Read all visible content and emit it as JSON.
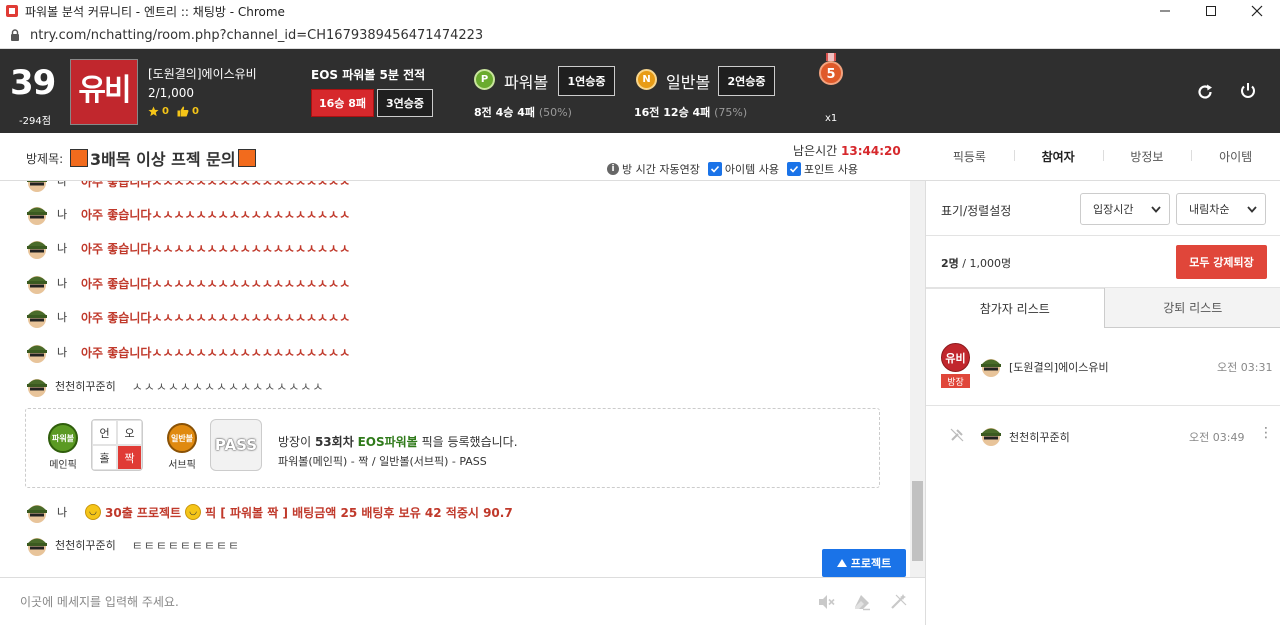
{
  "browser": {
    "window_title": "파워볼 분석 커뮤니티 - 엔트리 :: 채팅방 - Chrome",
    "url": "ntry.com/nchatting/room.php?channel_id=CH1679389456471474223"
  },
  "header": {
    "level": "39",
    "points": "-294점",
    "logo_text": "유비",
    "user_name": "[도원결의]에이스유비",
    "user_count": "2/1,000",
    "stars": "0",
    "likes": "0",
    "eos_title": "EOS 파워볼 5분 전적",
    "eos_record": "16승 8패",
    "eos_streak": "3연승중",
    "powerball": {
      "icon_letter": "P",
      "label": "파워볼",
      "streak": "1연승중",
      "record": "8전 4승 4패",
      "pct": "(50%)"
    },
    "ilban": {
      "icon_letter": "N",
      "label": "일반볼",
      "streak": "2연승중",
      "record": "16전 12승 4패",
      "pct": "(75%)"
    },
    "medal_number": "5",
    "medal_count": "x1"
  },
  "room": {
    "title_label": "방제목:",
    "title": "3배목 이상 프젝 문의",
    "remaining_label": "남은시간",
    "remaining_time": "13:44:20",
    "opt_extend": "방 시간 자동연장",
    "opt_item": "아이템 사용",
    "opt_point": "포인트 사용"
  },
  "right_tabs": [
    "픽등록",
    "참여자",
    "방정보",
    "아이템"
  ],
  "chat": {
    "me_label": "나",
    "repeat_msg": "아주 좋습니다ㅅㅅㅅㅅㅅㅅㅅㅅㅅㅅㅅㅅㅅㅅㅅㅅㅅㅅ",
    "other_user": "천천히꾸준히",
    "other_msg1": "ㅅㅅㅅㅅㅅㅅㅅㅅㅅㅅㅅㅅㅅㅅㅅㅅ",
    "pick": {
      "main_coin": "파워볼",
      "main_label": "메인픽",
      "grid": [
        "언",
        "오",
        "홀",
        "짝"
      ],
      "sub_coin": "일반볼",
      "sub_label": "서브픽",
      "pass": "PASS",
      "line1_pre": "방장이",
      "round": "53회차",
      "game": "EOS파워볼",
      "line1_post": "픽을 등록했습니다.",
      "line2": "파워볼(메인픽) - 짝 / 일반볼(서브픽) - PASS"
    },
    "project_msg_a": "30출 프로젝트",
    "project_msg_b": "픽 [ 파워볼 짝 ] 배팅금액 25 배팅후 보유 42 적중시 90.7",
    "other_msg2": "ㅌㅌㅌㅌㅌㅌㅌㅌㅌ",
    "project_button": "프로젝트"
  },
  "input": {
    "placeholder": "이곳에 메세지를 입력해 주세요."
  },
  "panel": {
    "sort_label": "표기/정렬설정",
    "sort_by": "입장시간",
    "sort_order": "내림차순",
    "count_now": "2명",
    "count_total": "/ 1,000명",
    "kick_all": "모두 강제퇴장",
    "tab_participants": "참가자 리스트",
    "tab_kicked": "강퇴 리스트",
    "host_logo": "유비",
    "host_badge": "방장",
    "host_name": "[도원결의]에이스유비",
    "host_time": "오전 03:31",
    "guest_name": "천천히꾸준히",
    "guest_time": "오전 03:49"
  }
}
